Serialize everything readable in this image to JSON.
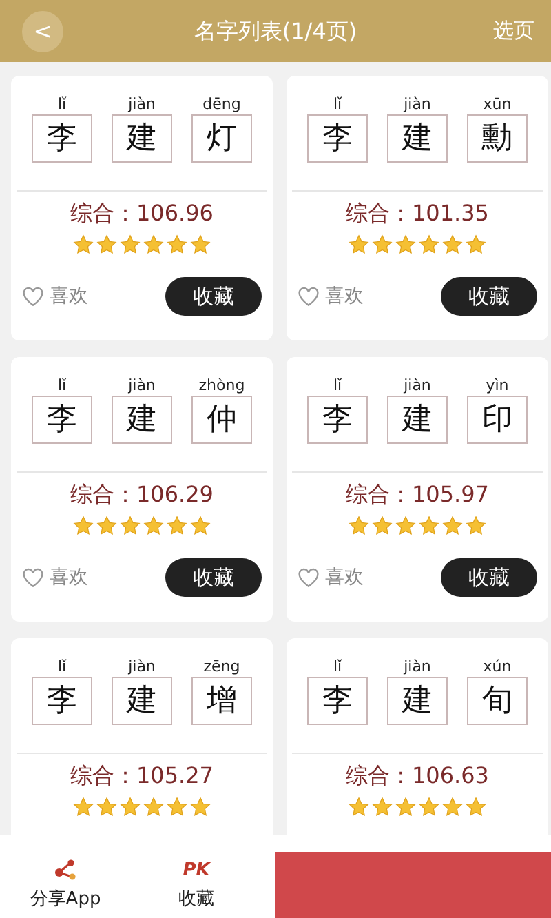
{
  "header": {
    "back": "<",
    "title": "名字列表(1/4页)",
    "action": "选页"
  },
  "names": [
    {
      "chars": [
        {
          "pinyin": "lǐ",
          "char": "李"
        },
        {
          "pinyin": "jiàn",
          "char": "建"
        },
        {
          "pinyin": "dēng",
          "char": "灯"
        }
      ],
      "score": "综合：106.96",
      "stars": 6,
      "like": "喜欢",
      "collect": "收藏"
    },
    {
      "chars": [
        {
          "pinyin": "lǐ",
          "char": "李"
        },
        {
          "pinyin": "jiàn",
          "char": "建"
        },
        {
          "pinyin": "xūn",
          "char": "勳"
        }
      ],
      "score": "综合：101.35",
      "stars": 6,
      "like": "喜欢",
      "collect": "收藏"
    },
    {
      "chars": [
        {
          "pinyin": "lǐ",
          "char": "李"
        },
        {
          "pinyin": "jiàn",
          "char": "建"
        },
        {
          "pinyin": "zhòng",
          "char": "仲"
        }
      ],
      "score": "综合：106.29",
      "stars": 6,
      "like": "喜欢",
      "collect": "收藏"
    },
    {
      "chars": [
        {
          "pinyin": "lǐ",
          "char": "李"
        },
        {
          "pinyin": "jiàn",
          "char": "建"
        },
        {
          "pinyin": "yìn",
          "char": "印"
        }
      ],
      "score": "综合：105.97",
      "stars": 6,
      "like": "喜欢",
      "collect": "收藏"
    },
    {
      "chars": [
        {
          "pinyin": "lǐ",
          "char": "李"
        },
        {
          "pinyin": "jiàn",
          "char": "建"
        },
        {
          "pinyin": "zēng",
          "char": "增"
        }
      ],
      "score": "综合：105.27",
      "stars": 6
    },
    {
      "chars": [
        {
          "pinyin": "lǐ",
          "char": "李"
        },
        {
          "pinyin": "jiàn",
          "char": "建"
        },
        {
          "pinyin": "xún",
          "char": "旬"
        }
      ],
      "score": "综合：106.63",
      "stars": 6
    }
  ],
  "bottom_bar": [
    {
      "kind": "share",
      "label": "分享App"
    },
    {
      "kind": "pk",
      "icon_text": "PK",
      "label": "收藏"
    },
    {
      "kind": "panel"
    }
  ]
}
